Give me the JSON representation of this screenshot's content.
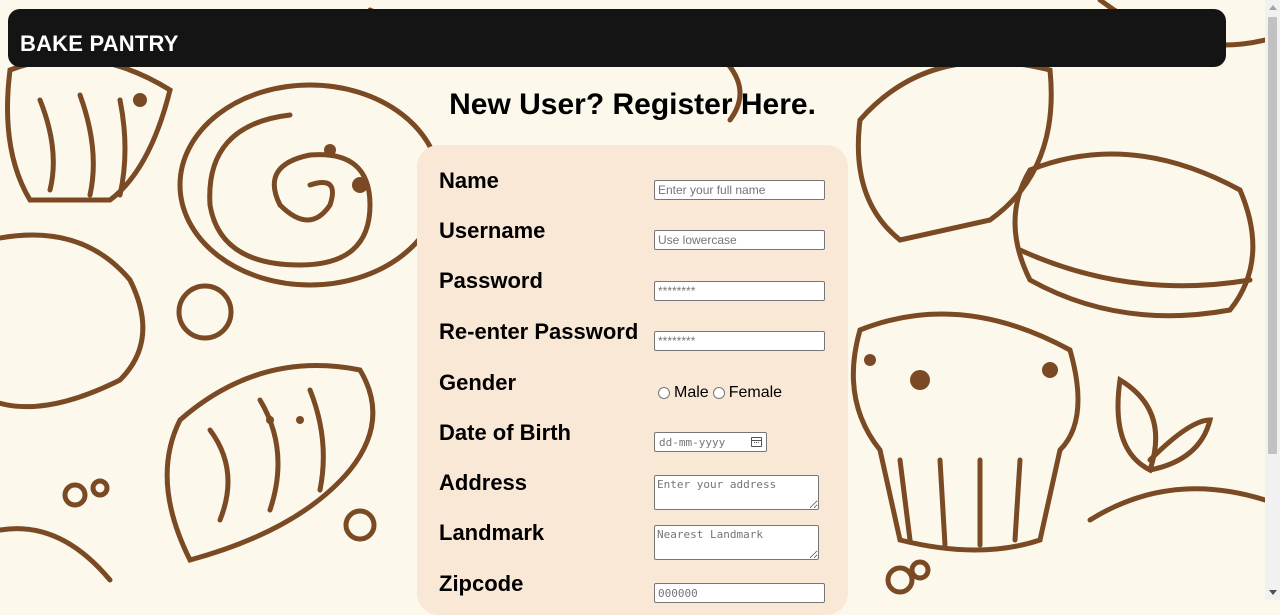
{
  "navbar": {
    "brand": "BAKE PANTRY"
  },
  "page": {
    "title": "New User? Register Here."
  },
  "form": {
    "name": {
      "label": "Name",
      "placeholder": "Enter your full name"
    },
    "username": {
      "label": "Username",
      "placeholder": "Use lowercase"
    },
    "password": {
      "label": "Password",
      "placeholder": "********"
    },
    "reenter_password": {
      "label": "Re-enter Password",
      "placeholder": "********"
    },
    "gender": {
      "label": "Gender",
      "options": [
        "Male",
        "Female"
      ]
    },
    "dob": {
      "label": "Date of Birth",
      "placeholder": "dd-mm-yyyy"
    },
    "address": {
      "label": "Address",
      "placeholder": "Enter your address"
    },
    "landmark": {
      "label": "Landmark",
      "placeholder": "Nearest Landmark"
    },
    "zipcode": {
      "label": "Zipcode",
      "placeholder": "000000"
    }
  },
  "colors": {
    "navbar": "#141414",
    "card": "#f9e8d6",
    "background": "#fdf8ec",
    "sketch": "#7a4a24"
  }
}
